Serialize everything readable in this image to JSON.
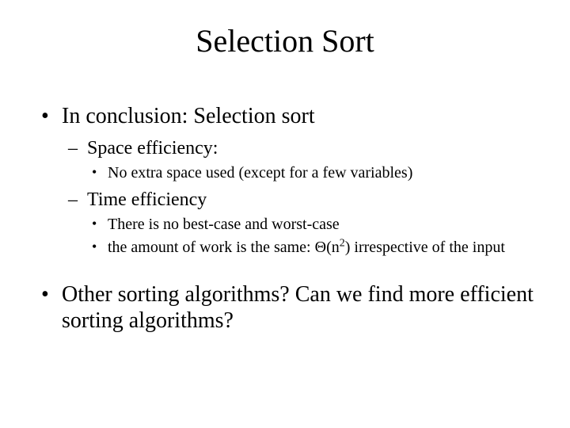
{
  "title": "Selection Sort",
  "bullets": {
    "b1": "In conclusion: Selection sort",
    "b1a": "Space efficiency:",
    "b1a1": "No extra space used (except for a few variables)",
    "b1b": "Time efficiency",
    "b1b1": "There is no best-case and worst-case",
    "b1b2_pre": "the amount of work is the same: ",
    "b1b2_theta": "Θ(n",
    "b1b2_exp": "2",
    "b1b2_post": ") irrespective of the input",
    "b2": "Other sorting algorithms?  Can we find more efficient sorting algorithms?"
  }
}
